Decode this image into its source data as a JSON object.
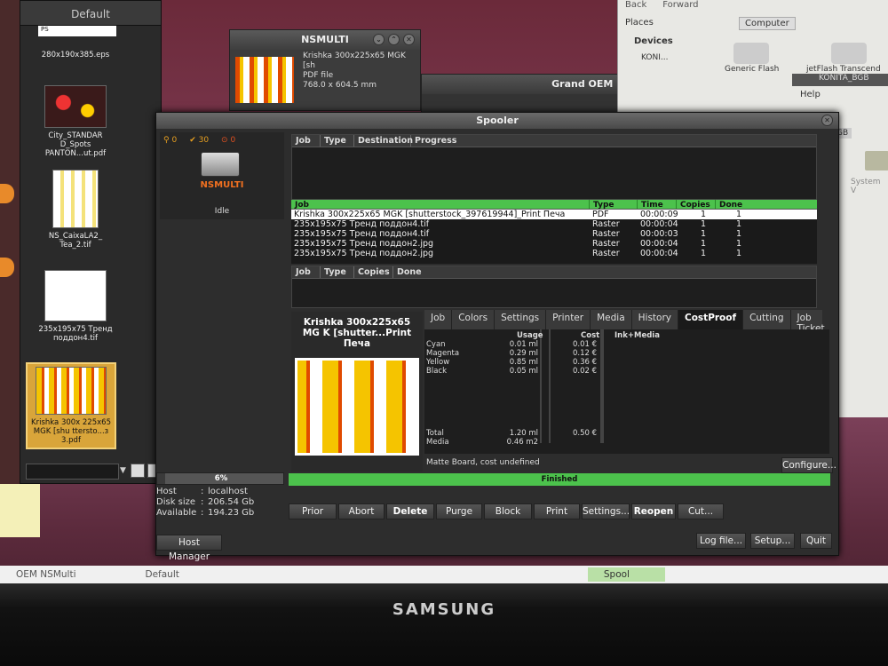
{
  "left_panel": {
    "title": "Default",
    "top_field": "PS",
    "thumbs": [
      {
        "label": "280x190x385.eps"
      },
      {
        "label": "City_STANDAR D_Spots PANTON...ut.pdf"
      },
      {
        "label": "NS_CaixaLA2_ Tea_2.tif"
      },
      {
        "label": "235x195x75 Тренд поддон4.tif"
      },
      {
        "label": "Krishka 300x 225x65 MGK [shu tterstо...з 3.pdf"
      }
    ]
  },
  "nsmulti_window": {
    "title": "NSMULTI",
    "file_name": "Krishka 300x225x65 MGK [sh",
    "file_type": "PDF file",
    "file_size": "768.0 x 604.5 mm"
  },
  "grand_oem_window": {
    "title": "Grand OEM NSMulti"
  },
  "file_manager": {
    "back": "Back",
    "forward": "Forward",
    "places": "Places",
    "devices": "Devices",
    "device_item": "KONI...",
    "computer": "Computer",
    "drives": [
      "Generic Flash",
      "jetFlash Transcend"
    ],
    "konita_title": "KONITA_BGB",
    "help": "Help",
    "bgb": "BGB",
    "system_v": "System V"
  },
  "spooler": {
    "title": "Spooler",
    "status_counts": {
      "queued": "0",
      "done": "30",
      "errors": "0"
    },
    "printer_name": "NSMULTI",
    "printer_status": "Idle",
    "active_headers": [
      "Job",
      "Type",
      "Destination",
      "Progress"
    ],
    "queue_headers": [
      "Job",
      "Type",
      "Time",
      "Copies",
      "Done"
    ],
    "queue_rows": [
      {
        "job": "Krishka 300x225x65 MGK [shutterstock_397619944]_Print Печа",
        "type": "PDF",
        "time": "00:00:09",
        "copies": "1",
        "done": "1"
      },
      {
        "job": "235x195x75 Тренд поддон4.tif",
        "type": "Raster",
        "time": "00:00:04",
        "copies": "1",
        "done": "1"
      },
      {
        "job": "235x195x75 Тренд поддон4.tif",
        "type": "Raster",
        "time": "00:00:03",
        "copies": "1",
        "done": "1"
      },
      {
        "job": "235x195x75 Тренд поддон2.jpg",
        "type": "Raster",
        "time": "00:00:04",
        "copies": "1",
        "done": "1"
      },
      {
        "job": "235x195x75 Тренд поддон2.jpg",
        "type": "Raster",
        "time": "00:00:04",
        "copies": "1",
        "done": "1"
      }
    ],
    "held_headers": [
      "Job",
      "Type",
      "Copies",
      "Done"
    ],
    "job_title": "Krishka 300x225x65 MG K [shutter...Print Печа",
    "tabs": [
      "Job",
      "Colors",
      "Settings",
      "Printer",
      "Media",
      "History",
      "CostProof",
      "Cutting",
      "Job Ticket"
    ],
    "active_tab": "CostProof",
    "cost": {
      "col_usage": "Usage",
      "col_cost": "Cost",
      "col_ink_media": "Ink+Media",
      "rows": [
        {
          "name": "Cyan",
          "usage": "0.01 ml",
          "cost": "0.01 €"
        },
        {
          "name": "Magenta",
          "usage": "0.29 ml",
          "cost": "0.12 €"
        },
        {
          "name": "Yellow",
          "usage": "0.85 ml",
          "cost": "0.36 €"
        },
        {
          "name": "Black",
          "usage": "0.05 ml",
          "cost": "0.02 €"
        }
      ],
      "total_label": "Total",
      "total_usage": "1.20 ml",
      "total_cost": "0.50 €",
      "media_label": "Media",
      "media_usage": "0.46 m2",
      "media_note": "Matte Board, cost undefined",
      "configure": "Configure..."
    },
    "progress_status": "Finished",
    "disk": {
      "percent_label": "6%",
      "percent": 6,
      "host_label": "Host",
      "host": "localhost",
      "disk_label": "Disk size",
      "disk": "206.54 Gb",
      "avail_label": "Available",
      "avail": "194.23 Gb"
    },
    "buttons": [
      "Prior",
      "Abort",
      "Delete",
      "Purge",
      "Block",
      "Print",
      "Settings...",
      "Reopen",
      "Cut..."
    ],
    "bottom_buttons": {
      "host_manager": "Host Manager",
      "log": "Log file...",
      "setup": "Setup...",
      "quit": "Quit"
    }
  },
  "taskbar": [
    "OEM NSMulti",
    "Default",
    "Spool"
  ],
  "monitor_brand": "SAMSUNG"
}
